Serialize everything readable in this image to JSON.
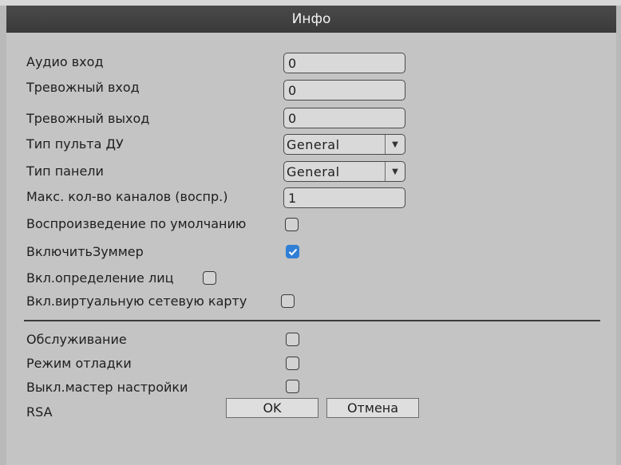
{
  "window": {
    "title": "Инфо"
  },
  "fields": {
    "audio_in": {
      "label": "Аудио вход",
      "value": "0"
    },
    "alarm_in": {
      "label": "Тревожный вход",
      "value": "0"
    },
    "alarm_out": {
      "label": "Тревожный выход",
      "value": "0"
    },
    "remote_type": {
      "label": "Тип пульта ДУ",
      "value": "General"
    },
    "panel_type": {
      "label": "Тип панели",
      "value": "General"
    },
    "max_channels": {
      "label": "Макс. кол-во каналов (воспр.)",
      "value": "1"
    }
  },
  "checkboxes": {
    "default_playback": {
      "label": "Воспроизведение по умолчанию",
      "checked": false
    },
    "buzzer": {
      "label": "ВключитьЗуммер",
      "checked": true
    },
    "face_detect": {
      "label": "Вкл.определение лиц",
      "checked": false
    },
    "virtual_nic": {
      "label": "Вкл.виртуальную сетевую карту",
      "checked": false
    },
    "maintenance": {
      "label": "Обслуживание",
      "checked": false
    },
    "debug_mode": {
      "label": "Режим отладки",
      "checked": false
    },
    "disable_wizard": {
      "label": "Выкл.мастер настройки",
      "checked": false
    },
    "rsa": {
      "label": "RSA",
      "checked": false
    }
  },
  "buttons": {
    "ok": "OK",
    "cancel": "Отмена"
  },
  "colors": {
    "accent": "#2f7fd6",
    "titlebar": "#404040",
    "background": "#c4c4c4"
  }
}
